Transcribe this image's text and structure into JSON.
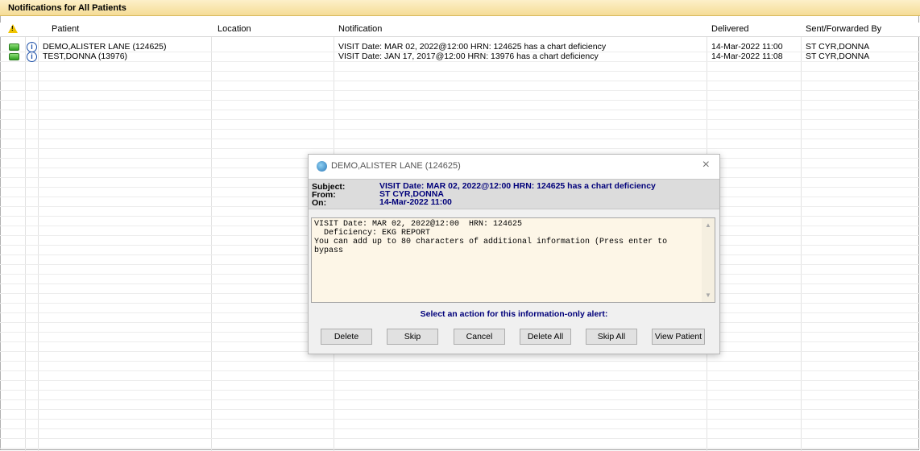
{
  "window": {
    "title": "Notifications for All Patients"
  },
  "columns": [
    "Patient",
    "Location",
    "Notification",
    "Delivered",
    "Sent/Forwarded By"
  ],
  "rows": [
    {
      "patient": "DEMO,ALISTER LANE  (124625)",
      "location": "",
      "notification": "VISIT Date: MAR 02, 2022@12:00  HRN: 124625  has a chart deficiency",
      "delivered": "14-Mar-2022 11:00",
      "sent_by": "ST CYR,DONNA"
    },
    {
      "patient": "TEST,DONNA  (13976)",
      "location": "",
      "notification": "VISIT Date: JAN 17, 2017@12:00  HRN: 13976  has a chart deficiency",
      "delivered": "14-Mar-2022 11:08",
      "sent_by": "ST CYR,DONNA"
    }
  ],
  "icons": {
    "warning": "warning-icon",
    "status": "green-status-icon",
    "info": "info-icon"
  },
  "dialog": {
    "title": "DEMO,ALISTER LANE   (124625)",
    "close": "×",
    "subject_label": "Subject:",
    "subject": "VISIT Date: MAR 02, 2022@12:00  HRN: 124625  has a chart deficiency",
    "from_label": "From:",
    "from": "ST CYR,DONNA",
    "on_label": "On:",
    "on": "14-Mar-2022 11:00",
    "message": "VISIT Date: MAR 02, 2022@12:00  HRN: 124625\n  Deficiency: EKG REPORT\nYou can add up to 80 characters of additional information (Press enter to bypass",
    "action_prompt": "Select an action for this information-only alert:",
    "buttons": [
      "Delete",
      "Skip",
      "Cancel",
      "Delete All",
      "Skip All",
      "View Patient"
    ]
  },
  "colors": {
    "title_bar": "#f5dc96",
    "dialog_label": "#00007a",
    "memo_bg": "#fdf6e7"
  }
}
